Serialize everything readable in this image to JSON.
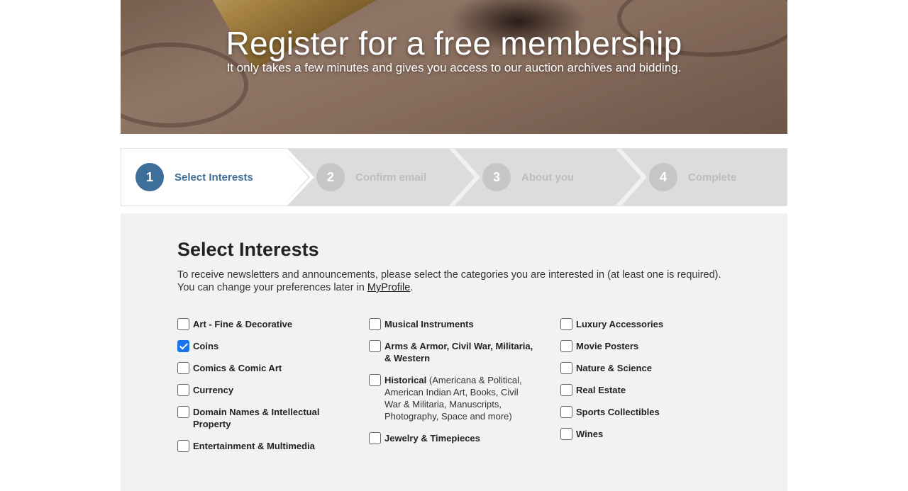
{
  "hero": {
    "title": "Register for a free membership",
    "subtitle": "It only takes a few minutes and gives you access to our auction archives and bidding."
  },
  "steps": [
    {
      "number": "1",
      "label": "Select Interests",
      "active": true
    },
    {
      "number": "2",
      "label": "Confirm email",
      "active": false
    },
    {
      "number": "3",
      "label": "About you",
      "active": false
    },
    {
      "number": "4",
      "label": "Complete",
      "active": false
    }
  ],
  "interests": {
    "title": "Select Interests",
    "intro_text": "To receive newsletters and announcements, please select the categories you are interested in (at least one is required). You can change your preferences later in ",
    "intro_link": "MyProfile",
    "intro_end": ".",
    "columns": [
      [
        {
          "label": "Art - Fine & Decorative",
          "checked": false
        },
        {
          "label": "Coins",
          "checked": true
        },
        {
          "label": "Comics & Comic Art",
          "checked": false
        },
        {
          "label": "Currency",
          "checked": false
        },
        {
          "label": "Domain Names & Intellectual Property",
          "checked": false
        },
        {
          "label": "Entertainment & Multimedia",
          "checked": false
        }
      ],
      [
        {
          "label": "Musical Instruments",
          "checked": false
        },
        {
          "label": "Arms & Armor, Civil War, Militaria, & Western",
          "checked": false
        },
        {
          "label": "Historical",
          "note": "(Americana & Political, American Indian Art, Books, Civil War & Militaria, Manuscripts, Photography, Space and more)",
          "checked": false
        },
        {
          "label": "Jewelry & Timepieces",
          "checked": false
        }
      ],
      [
        {
          "label": "Luxury Accessories",
          "checked": false
        },
        {
          "label": "Movie Posters",
          "checked": false
        },
        {
          "label": "Nature & Science",
          "checked": false
        },
        {
          "label": "Real Estate",
          "checked": false
        },
        {
          "label": "Sports Collectibles",
          "checked": false
        },
        {
          "label": "Wines",
          "checked": false
        }
      ]
    ]
  },
  "colors": {
    "accent": "#3e6f9a",
    "checkbox_checked": "#1a73e8",
    "panel_bg": "#f2f2f2",
    "steps_inactive_bg": "#dcdcdc"
  }
}
